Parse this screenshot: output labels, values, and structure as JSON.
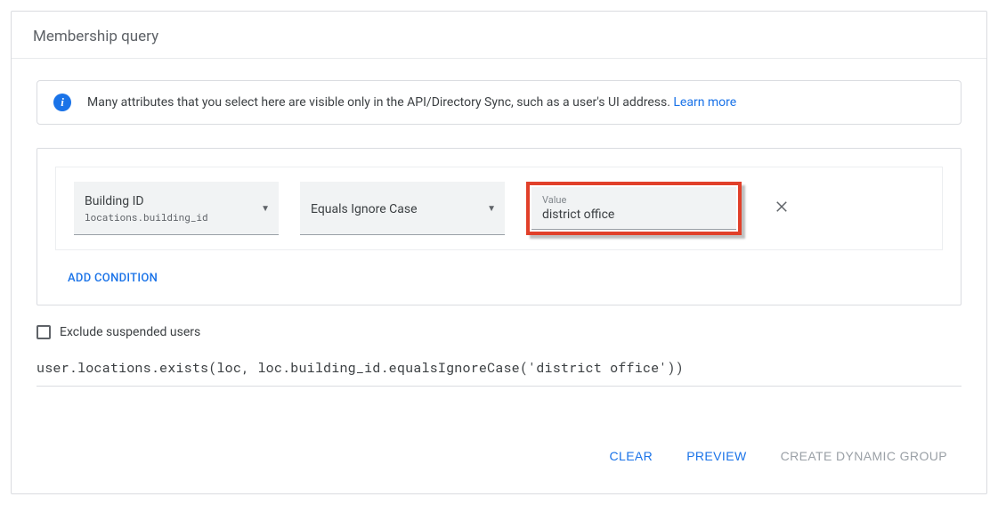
{
  "header": {
    "title": "Membership query"
  },
  "info": {
    "text": "Many attributes that you select here are visible only in the API/Directory Sync, such as a user's UI address.",
    "learn_more": "Learn more"
  },
  "condition": {
    "attribute": {
      "label": "Building ID",
      "path": "locations.building_id"
    },
    "operator": {
      "label": "Equals Ignore Case"
    },
    "value": {
      "label": "Value",
      "text": "district office"
    }
  },
  "add_condition": "ADD CONDITION",
  "exclude_suspended": {
    "label": "Exclude suspended users",
    "checked": false
  },
  "query_string": "user.locations.exists(loc, loc.building_id.equalsIgnoreCase('district office'))",
  "actions": {
    "clear": "CLEAR",
    "preview": "PREVIEW",
    "create": "CREATE DYNAMIC GROUP"
  }
}
